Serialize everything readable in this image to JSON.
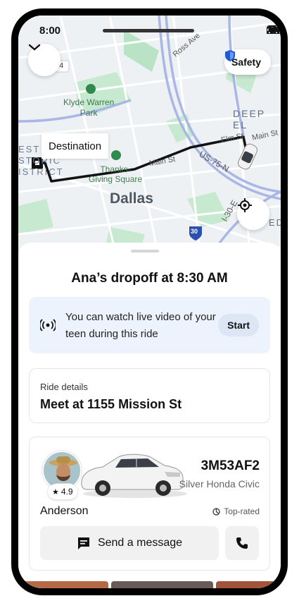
{
  "status_bar": {
    "time": "8:00"
  },
  "map": {
    "labels": {
      "ross_ave": "Ross Ave",
      "klyde_warren_park": "Klyde Warren\nPark",
      "deep_ellum": "DEEP EL",
      "elm_st": "Elm St",
      "main_st_right": "Main St",
      "us_75_n": "US-75-N",
      "historic_district": "EST\nSTORIC\nISTRICT",
      "thanksgiving_square": "Thanks-\nGiving Square",
      "main_st_center": "Main St",
      "dallas": "Dallas",
      "i_30_e": "I-30-E",
      "highway_30": "30",
      "highway_54": "54",
      "ed": "ED"
    },
    "destination_label": "Destination",
    "safety_label": "Safety"
  },
  "sheet": {
    "title": "Ana’s dropoff at 8:30 AM",
    "live_video": {
      "text": "You can watch live video of your teen during this ride",
      "start_label": "Start"
    },
    "ride_details": {
      "label": "Ride details",
      "value": "Meet at 1155 Mission St"
    },
    "driver": {
      "rating": "4.9",
      "plate": "3M53AF2",
      "car_model": "Silver Honda Civic",
      "name": "Anderson",
      "badge": "Top-rated",
      "message_label": "Send a message"
    }
  },
  "colors": {
    "accent_blue": "#1f5ad6",
    "live_card_bg": "#edf3fd",
    "route": "#111111",
    "park_green": "#b9e3c4"
  }
}
